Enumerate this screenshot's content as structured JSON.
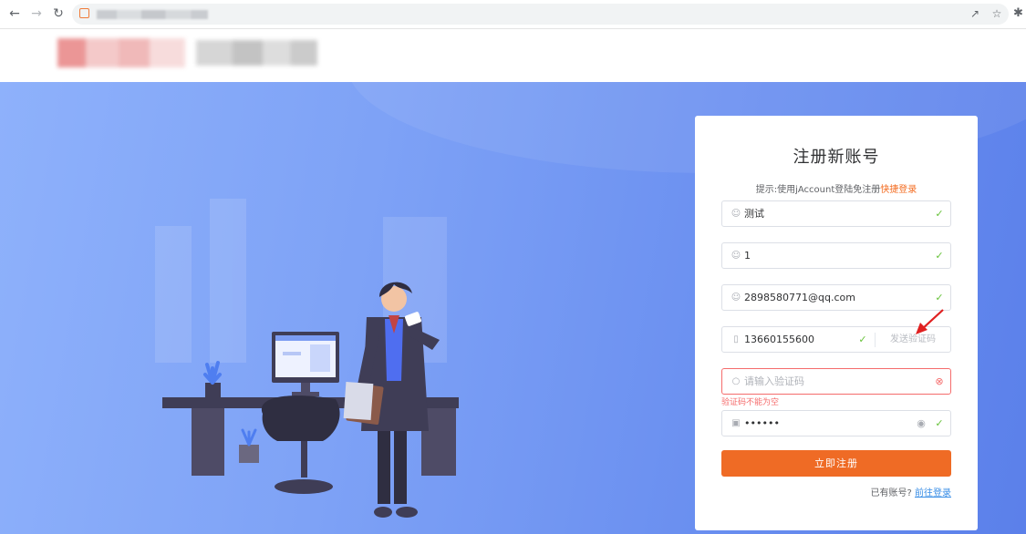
{
  "browser": {
    "icons": {
      "back": "arrow-left-icon",
      "forward": "arrow-right-icon",
      "reload": "reload-icon",
      "share": "share-icon",
      "bookmark": "star-icon",
      "extensions": "puzzle-icon"
    }
  },
  "register": {
    "title": "注册新账号",
    "hint_prefix": "提示:使用jAccount登陆免注册",
    "hint_link": "快捷登录",
    "fields": {
      "nickname": "测试",
      "username": "1",
      "email": "2898580771@qq.com",
      "phone": "13660155600",
      "send_code_label": "发送验证码",
      "code_placeholder": "请输入验证码",
      "code_error": "验证码不能为空",
      "password_mask": "••••••"
    },
    "submit_label": "立即注册",
    "has_account": "已有账号?",
    "login_link": "前往登录"
  },
  "colors": {
    "accent": "#ef6b25",
    "success": "#67c23a",
    "error": "#f56c6c",
    "link": "#3a8ee6",
    "hero": "#7ea2f6"
  }
}
